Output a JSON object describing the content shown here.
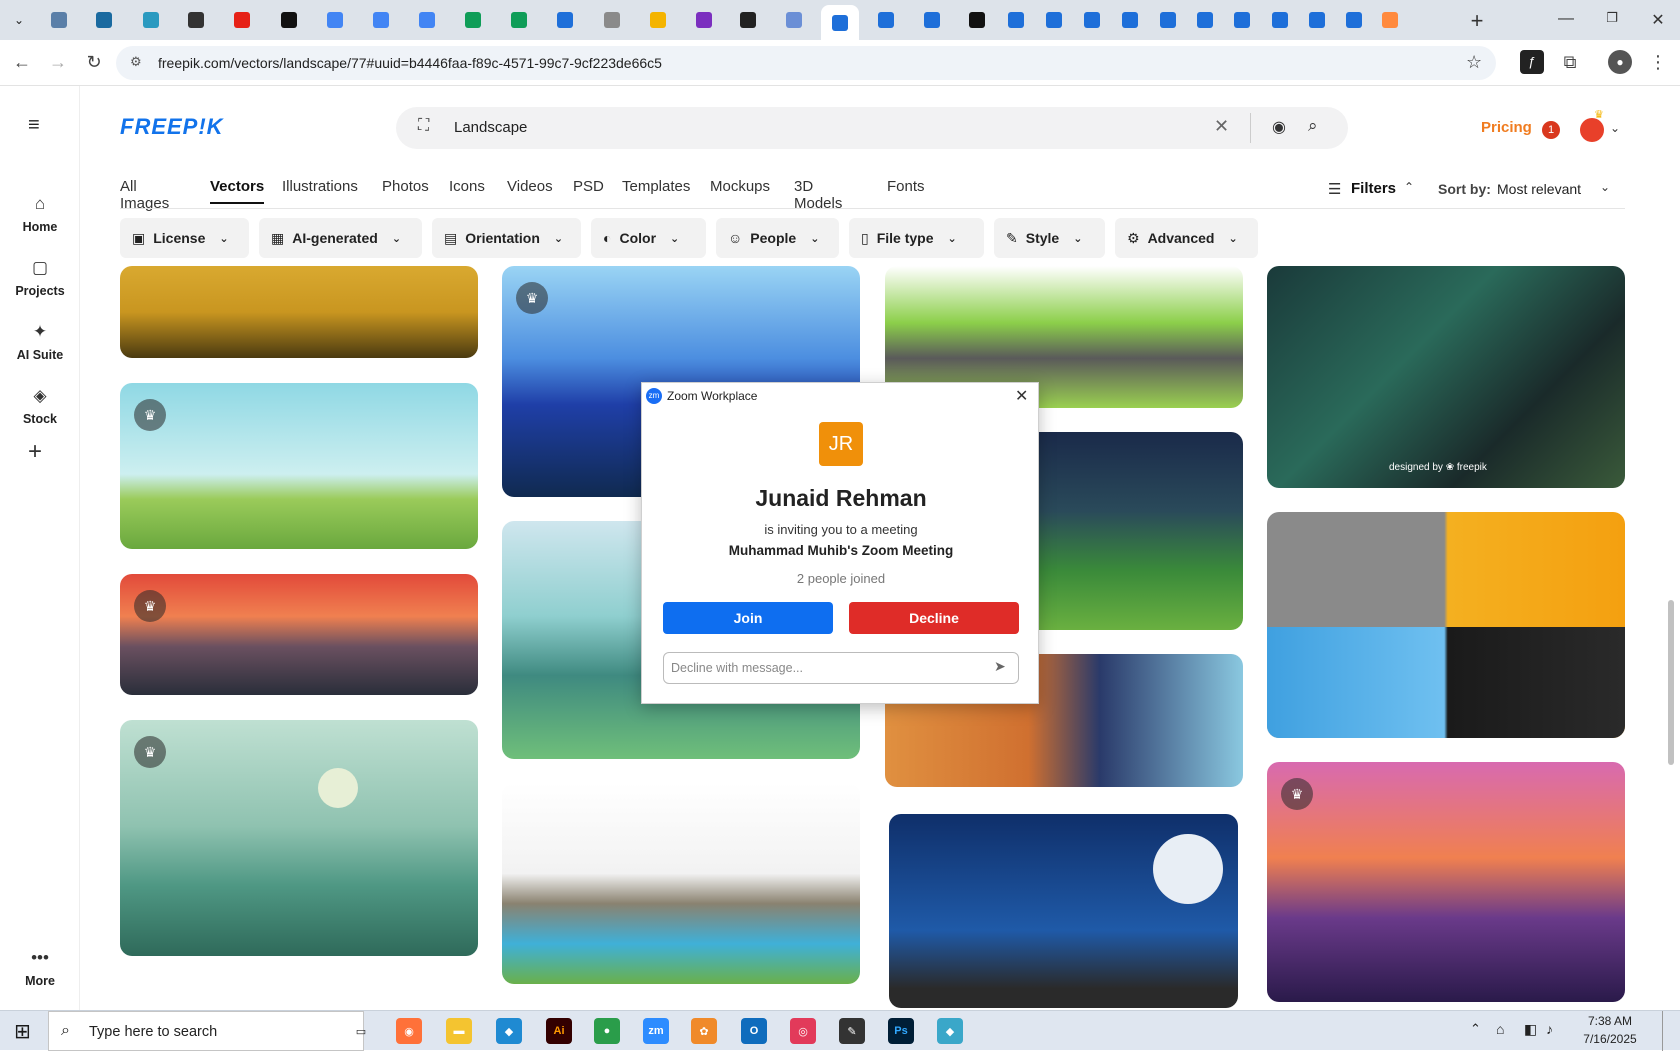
{
  "browser": {
    "url": "freepik.com/vectors/landscape/77#uuid=b4446faa-f89c-4571-99c7-9cf223de66c5",
    "tab_favicon_colors": [
      "#5a7fa8",
      "#1a6aa0",
      "#2a9ac0",
      "#333",
      "#e62117",
      "#111",
      "#4285f4",
      "#4285f4",
      "#4285f4",
      "#0f9d58",
      "#0f9d58",
      "#1e6fd9",
      "#8a8a8a",
      "#f4b400",
      "#7b2fbf",
      "#222",
      "#6b8fd6",
      "#1e6fd9",
      "#1e6fd9",
      "#1e6fd9",
      "#111",
      "#1e6fd9",
      "#1e6fd9",
      "#1e6fd9",
      "#1e6fd9",
      "#1e6fd9",
      "#1e6fd9",
      "#1e6fd9",
      "#1e6fd9",
      "#1e6fd9",
      "#1e6fd9",
      "#ff8a3d"
    ],
    "active_tab_index": 17
  },
  "freepik": {
    "logo": "FREEP!K",
    "search_value": "Landscape",
    "pricing": "Pricing",
    "notification_count": "1",
    "sidebar": [
      {
        "label": "Home",
        "icon": "home-icon",
        "glyph": "⌂"
      },
      {
        "label": "Projects",
        "icon": "projects-icon",
        "glyph": "▢"
      },
      {
        "label": "AI Suite",
        "icon": "sparkle-icon",
        "glyph": "✦"
      },
      {
        "label": "Stock",
        "icon": "stock-icon",
        "glyph": "◈"
      }
    ],
    "more_label": "More",
    "categories": [
      "All Images",
      "Vectors",
      "Illustrations",
      "Photos",
      "Icons",
      "Videos",
      "PSD",
      "Templates",
      "Mockups",
      "3D Models",
      "Fonts"
    ],
    "filters_label": "Filters",
    "sort_label": "Sort by:",
    "sort_value": "Most relevant",
    "filter_buttons": [
      "License",
      "AI-generated",
      "Orientation",
      "Color",
      "People",
      "File type",
      "Style",
      "Advanced"
    ],
    "watermark": "designed by ❀ freepik"
  },
  "zoom": {
    "app_title": "Zoom Workplace",
    "app_badge": "zm",
    "initials": "JR",
    "host": "Junaid Rehman",
    "invite_text": "is inviting you to a meeting",
    "meeting": "Muhammad Muhib's Zoom Meeting",
    "joined": "2 people joined",
    "join": "Join",
    "decline": "Decline",
    "decline_placeholder": "Decline with message..."
  },
  "taskbar": {
    "search_placeholder": "Type here to search",
    "time": "7:38 AM",
    "date": "7/16/2025"
  }
}
